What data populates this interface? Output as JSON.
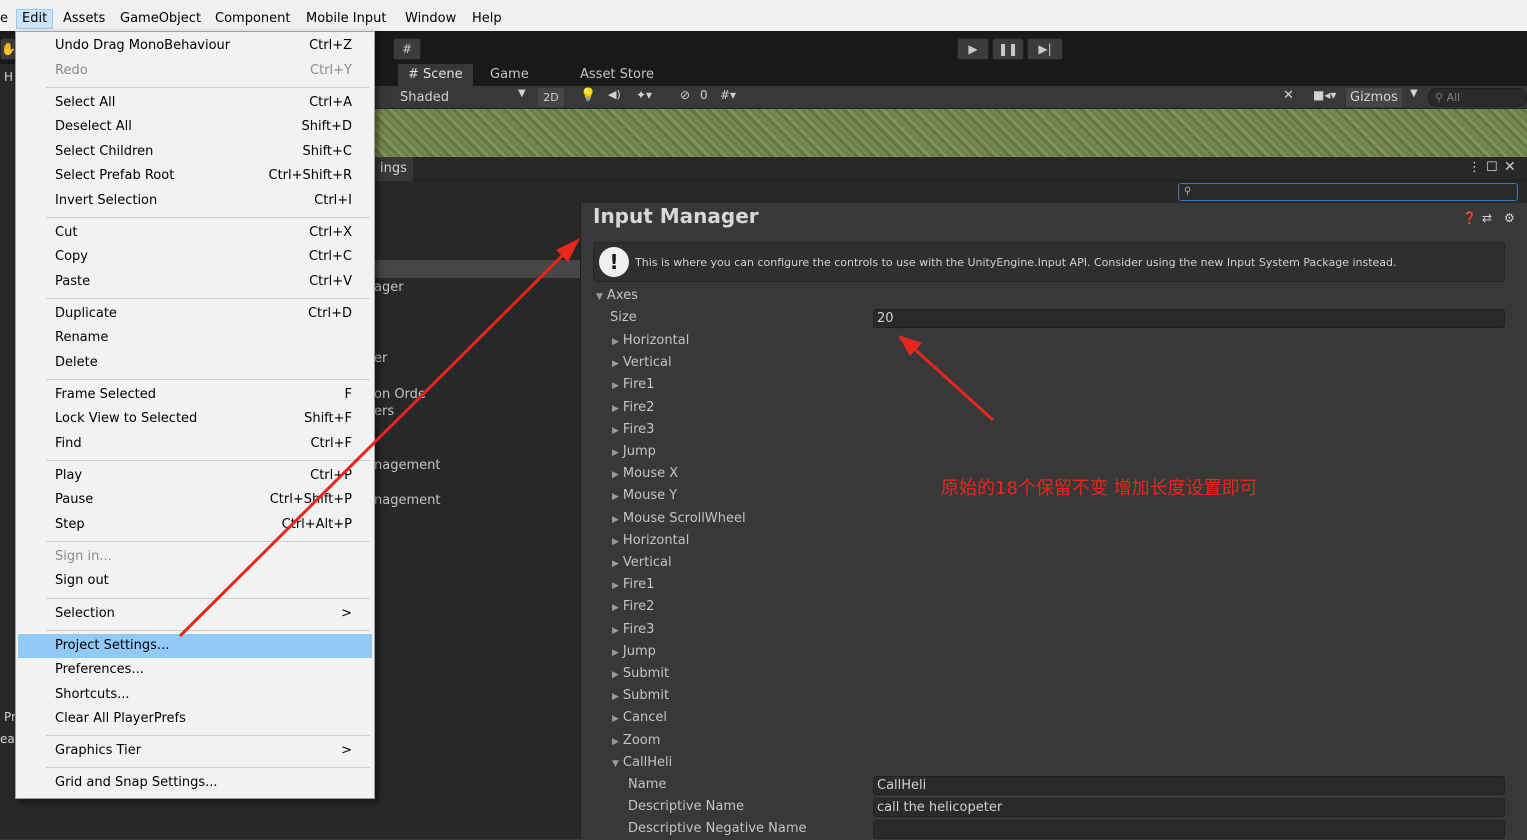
{
  "menubar": {
    "items": [
      "e",
      "Edit",
      "Assets",
      "GameObject",
      "Component",
      "Mobile Input",
      "Window",
      "Help"
    ]
  },
  "toolbar": {
    "play_icon": "play-icon",
    "pause_icon": "pause-icon",
    "step_icon": "step-icon"
  },
  "scene": {
    "tabs": [
      "# Scene",
      "Game",
      "Asset Store"
    ],
    "shading": "Shaded",
    "mode_2d": "2D",
    "hidden_count": "0",
    "gizmos": "Gizmos",
    "search_placeholder": "All"
  },
  "settings_window": {
    "tab_fragment": "ings",
    "left_fragments": [
      "ager",
      "er",
      "on Orde",
      "ers",
      "nagement",
      "nagement"
    ],
    "title": "Input Manager",
    "info": "This is where you can configure the controls to use with the UnityEngine.Input API. Consider using the new Input System Package instead.",
    "axes_label": "Axes",
    "size_label": "Size",
    "size_value": "20",
    "axes": [
      "Horizontal",
      "Vertical",
      "Fire1",
      "Fire2",
      "Fire3",
      "Jump",
      "Mouse X",
      "Mouse Y",
      "Mouse ScrollWheel",
      "Horizontal",
      "Vertical",
      "Fire1",
      "Fire2",
      "Fire3",
      "Jump",
      "Submit",
      "Submit",
      "Cancel",
      "Zoom"
    ],
    "expanded_axis": "CallHeli",
    "name_label": "Name",
    "name_value": "CallHeli",
    "desc_label": "Descriptive Name",
    "desc_value": "call the helicopeter",
    "desc_neg_label": "Descriptive Negative Name",
    "desc_neg_value": ""
  },
  "edit_menu": {
    "items": [
      {
        "label": "Undo Drag MonoBehaviour",
        "shortcut": "Ctrl+Z"
      },
      {
        "label": "Redo",
        "shortcut": "Ctrl+Y"
      },
      {
        "label": "Select All",
        "shortcut": "Ctrl+A"
      },
      {
        "label": "Deselect All",
        "shortcut": "Shift+D"
      },
      {
        "label": "Select Children",
        "shortcut": "Shift+C"
      },
      {
        "label": "Select Prefab Root",
        "shortcut": "Ctrl+Shift+R"
      },
      {
        "label": "Invert Selection",
        "shortcut": "Ctrl+I"
      },
      {
        "label": "Cut",
        "shortcut": "Ctrl+X"
      },
      {
        "label": "Copy",
        "shortcut": "Ctrl+C"
      },
      {
        "label": "Paste",
        "shortcut": "Ctrl+V"
      },
      {
        "label": "Duplicate",
        "shortcut": "Ctrl+D"
      },
      {
        "label": "Rename",
        "shortcut": ""
      },
      {
        "label": "Delete",
        "shortcut": ""
      },
      {
        "label": "Frame Selected",
        "shortcut": "F"
      },
      {
        "label": "Lock View to Selected",
        "shortcut": "Shift+F"
      },
      {
        "label": "Find",
        "shortcut": "Ctrl+F"
      },
      {
        "label": "Play",
        "shortcut": "Ctrl+P"
      },
      {
        "label": "Pause",
        "shortcut": "Ctrl+Shift+P"
      },
      {
        "label": "Step",
        "shortcut": "Ctrl+Alt+P"
      },
      {
        "label": "Sign in...",
        "shortcut": ""
      },
      {
        "label": "Sign out",
        "shortcut": ""
      },
      {
        "label": "Selection",
        "shortcut": ">"
      },
      {
        "label": "Project Settings...",
        "shortcut": ""
      },
      {
        "label": "Preferences...",
        "shortcut": ""
      },
      {
        "label": "Shortcuts...",
        "shortcut": ""
      },
      {
        "label": "Clear All PlayerPrefs",
        "shortcut": ""
      },
      {
        "label": "Graphics Tier",
        "shortcut": ">"
      },
      {
        "label": "Grid and Snap Settings...",
        "shortcut": ""
      }
    ]
  },
  "left_panel": {
    "fragments": [
      "H",
      "Pr",
      "ea"
    ]
  },
  "annotation": {
    "text": "原始的18个保留不变 增加长度设置即可",
    "color": "#e8261e"
  }
}
